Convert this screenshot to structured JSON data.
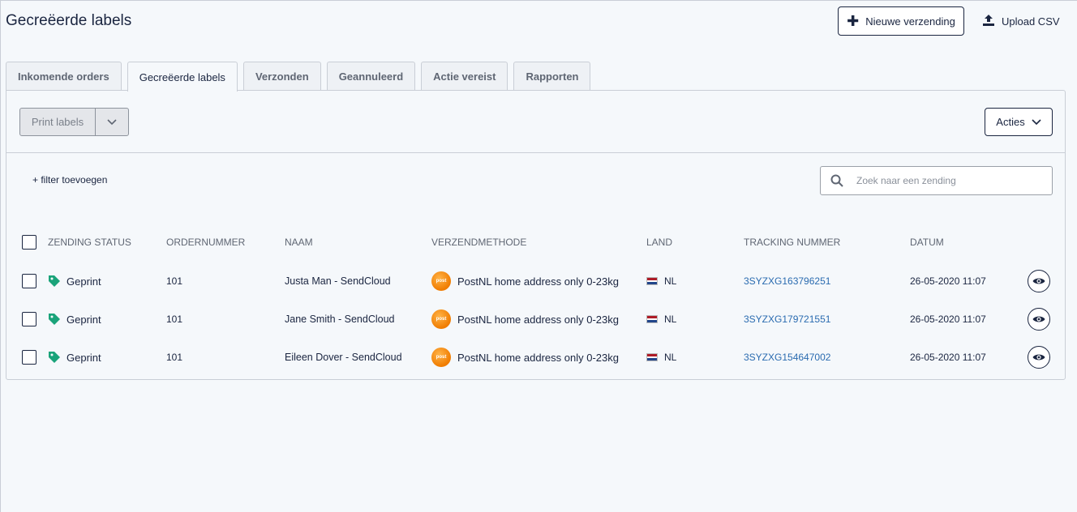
{
  "page": {
    "title": "Gecreëerde labels"
  },
  "header": {
    "new_shipment_label": "Nieuwe verzending",
    "upload_label": "Upload CSV"
  },
  "tabs": [
    {
      "label": "Inkomende orders",
      "active": false
    },
    {
      "label": "Gecreëerde labels",
      "active": true
    },
    {
      "label": "Verzonden",
      "active": false
    },
    {
      "label": "Geannuleerd",
      "active": false
    },
    {
      "label": "Actie vereist",
      "active": false
    },
    {
      "label": "Rapporten",
      "active": false
    }
  ],
  "toolbar": {
    "print_label": "Print labels",
    "actions_label": "Acties"
  },
  "filter": {
    "add_label": "+ filter toevoegen",
    "search_placeholder": "Zoek naar een zending"
  },
  "table": {
    "headers": [
      "ZENDING STATUS",
      "ORDERNUMMER",
      "NAAM",
      "VERZENDMETHODE",
      "LAND",
      "TRACKING NUMMER",
      "DATUM"
    ],
    "rows": [
      {
        "status": "Geprint",
        "order": "101",
        "name": "Justa Man - SendCloud",
        "method": "PostNL home address only 0-23kg",
        "country": "NL",
        "tracking": "3SYZXG163796251",
        "date": "26-05-2020 11:07"
      },
      {
        "status": "Geprint",
        "order": "101",
        "name": "Jane Smith - SendCloud",
        "method": "PostNL home address only 0-23kg",
        "country": "NL",
        "tracking": "3SYZXG179721551",
        "date": "26-05-2020 11:07"
      },
      {
        "status": "Geprint",
        "order": "101",
        "name": "Eileen Dover - SendCloud",
        "method": "PostNL home address only 0-23kg",
        "country": "NL",
        "tracking": "3SYZXG154647002",
        "date": "26-05-2020 11:07"
      }
    ]
  },
  "colors": {
    "tag": "#1aa37a",
    "link": "#2a6bb0",
    "primary": "#1a2540",
    "postnl": "#f07c00"
  },
  "icons": {
    "tag": "tag-icon",
    "eye": "eye-icon",
    "search": "search-icon",
    "plus": "plus-icon",
    "upload": "upload-icon",
    "chevron": "chevron-down-icon"
  }
}
